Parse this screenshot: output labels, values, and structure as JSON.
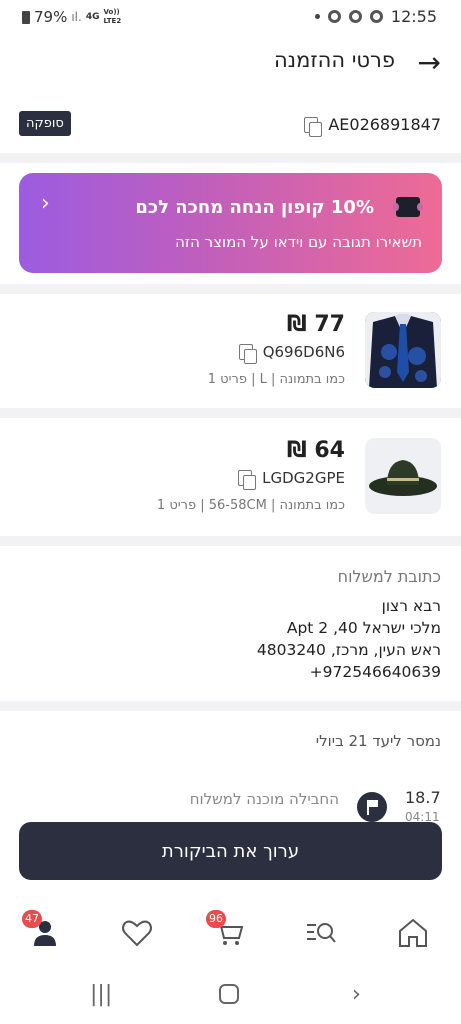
{
  "status_bar": {
    "battery": "79%",
    "network": "4G",
    "volte": "Vo))",
    "lte": "LTE2",
    "time": "12:55"
  },
  "header": {
    "title": "פרטי ההזמנה"
  },
  "order": {
    "id": "AE026891847",
    "status_badge": "סופקה"
  },
  "coupon": {
    "title": "10% קופון הנחה מחכה לכם",
    "subtitle": "תשאירו תגובה עם וידאו על המוצר הזה"
  },
  "products": [
    {
      "price": "77 ₪",
      "sku": "Q696D6N6",
      "meta": "כמו בתמונה | L | פריט 1",
      "image_icon": "vest-tie-icon"
    },
    {
      "price": "64 ₪",
      "sku": "LGDG2GPE",
      "meta": "כמו בתמונה | 56-58CM | פריט 1",
      "image_icon": "hat-icon"
    }
  ],
  "shipping": {
    "label": "כתובת למשלוח",
    "name": "רבא רצון",
    "street": "מלכי ישראל 40, Apt 2",
    "city": "ראש העין, מרכז, 4803240",
    "phone": "+972546640639"
  },
  "delivery": {
    "eta": "נמסר ליעד 21 ביולי",
    "event_label": "החבילה מוכנה למשלוח",
    "event_date": "18.7",
    "event_time": "04:11"
  },
  "cta": {
    "label": "ערוך את הביקורת"
  },
  "bottom_nav": {
    "account_badge": "47",
    "cart_badge": "96"
  },
  "colors": {
    "dark": "#2b2f3f",
    "badge_red": "#e84c4c",
    "coupon_start": "#9c5ce0",
    "coupon_end": "#ee6b95"
  }
}
